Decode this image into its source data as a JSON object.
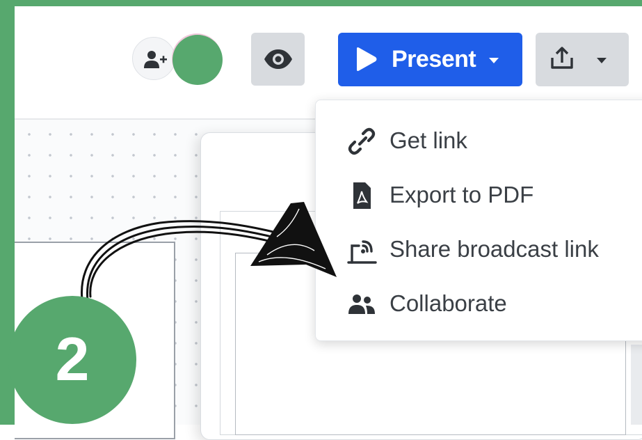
{
  "toolbar": {
    "present_label": "Present"
  },
  "share_menu": {
    "items": [
      {
        "label": "Get link",
        "icon": "link-icon"
      },
      {
        "label": "Export to PDF",
        "icon": "pdf-file-icon"
      },
      {
        "label": "Share broadcast link",
        "icon": "broadcast-icon"
      },
      {
        "label": "Collaborate",
        "icon": "users-icon"
      }
    ]
  },
  "annotation": {
    "step_number": "2"
  },
  "colors": {
    "frame_green": "#57a86e",
    "present_blue": "#1f5ee9",
    "button_gray": "#d8dbdf",
    "menu_text": "#3a3f45"
  }
}
